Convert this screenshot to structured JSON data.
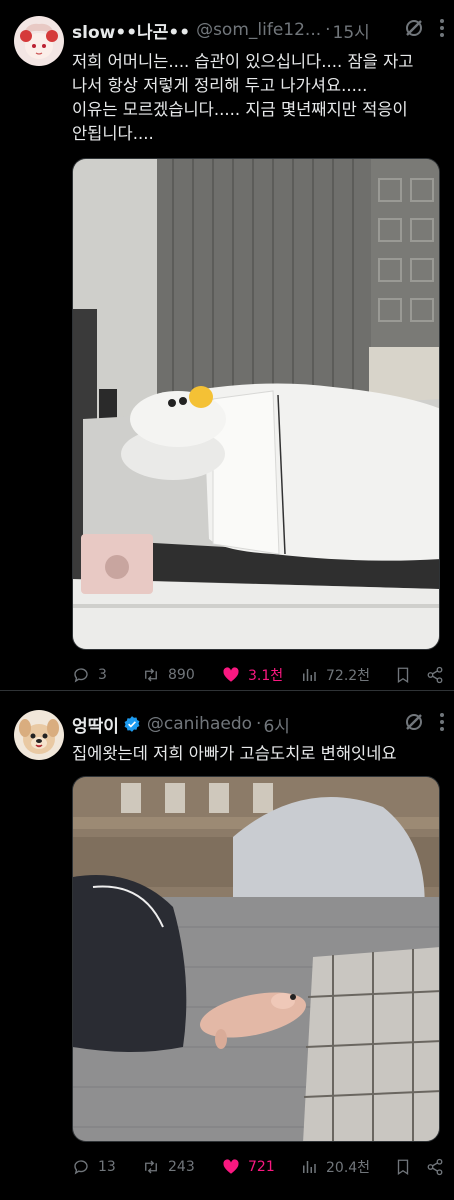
{
  "tweets": [
    {
      "author_name": "slow••나곤••",
      "handle": "@som_life12...",
      "dot": "·",
      "time": "15시",
      "text": "저희 어머니는.... 습관이 있으십니다.... 잠을 자고\n나서 항상 저렇게 정리해 두고 나가셔요.....\n이유는 모르겠습니다..... 지금 몇년째지만 적응이\n안됩니다....",
      "replies": "3",
      "retweets": "890",
      "likes": "3.1천",
      "views": "72.2천",
      "liked": true
    },
    {
      "author_name": "엉딱이",
      "handle": "@canihaedo",
      "dot": "·",
      "time": "6시",
      "text": "집에왓는데 저희 아빠가 고슴도치로 변해잇네요",
      "replies": "13",
      "retweets": "243",
      "likes": "721",
      "views": "20.4천",
      "liked": true,
      "verified": true
    }
  ],
  "colors": {
    "background": "#000000",
    "text": "#e7e9ea",
    "muted": "#71767b",
    "like": "#f91880",
    "verified": "#1d9bf0"
  },
  "icons": [
    "reply-icon",
    "retweet-icon",
    "like-icon",
    "views-icon",
    "bookmark-icon",
    "share-icon",
    "grok-icon",
    "more-icon",
    "verified-icon"
  ]
}
